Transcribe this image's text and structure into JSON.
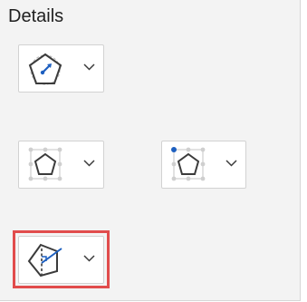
{
  "section": {
    "title": "Details"
  },
  "controls": [
    {
      "id": "radius-dropdown",
      "icon": "pentagon-radius-icon"
    },
    {
      "id": "vertices-dropdown",
      "icon": "pentagon-vertices-icon"
    },
    {
      "id": "vertex-dropdown",
      "icon": "pentagon-vertex-icon"
    },
    {
      "id": "apothem-dropdown",
      "icon": "pentagon-apothem-icon",
      "highlighted": true
    }
  ],
  "colors": {
    "panel_background": "#f3f3f3",
    "shape_stroke": "#3b3b3b",
    "accent_blue": "#1d5fbf",
    "guide_gray": "#bdbdbd",
    "highlight_red": "#e14c4c"
  }
}
